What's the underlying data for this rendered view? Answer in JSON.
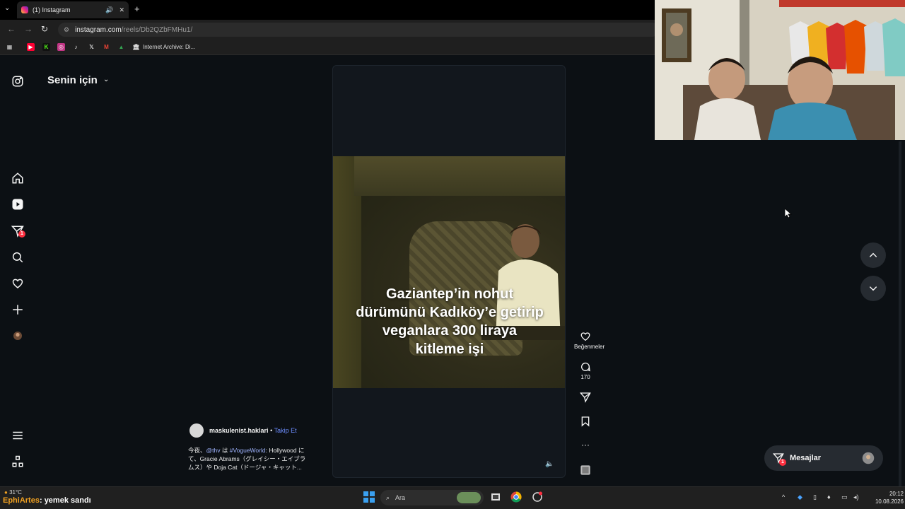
{
  "browser": {
    "tab_title": "(1) Instagram",
    "url_host": "instagram.com",
    "url_path": "/reels/Db2QZbFMHu1/",
    "bookmark_label": "Internet Archive: Di..."
  },
  "instagram": {
    "feed_title": "Senin için",
    "nav_badge": "1",
    "reel": {
      "caption_lines": [
        "Gaziantep’in nohut",
        "dürümünü Kadıköy’e getirip",
        "veganlara 300 liraya",
        "kitleme işi"
      ]
    },
    "actions": {
      "likes_label": "Beğenmeler",
      "comments_count": "170"
    },
    "author": {
      "username": "maskulenist.haklari",
      "separator": "•",
      "follow_label": "Takip Et",
      "desc_line1_pre": "今夜、",
      "desc_mention": "@thv",
      "desc_mid": " は ",
      "desc_hashtag": "#VogueWorld",
      "desc_line1_post": ": Hollywood に",
      "desc_line2": "て、Gracie Abrams（グレイシー・エイブラ",
      "desc_line3": "ムス）や Doja Cat（ドージャ・キャット..."
    },
    "messages_label": "Mesajlar",
    "messages_badge": "1"
  },
  "taskbar": {
    "temperature": "31°C",
    "overlay_brand": "EphiArtes",
    "overlay_rest": ": yemek sandı",
    "search_placeholder": "Ara",
    "time": "20:12",
    "date": "10.08.2026"
  },
  "colors": {
    "accent_blue": "#6d8dff",
    "badge_red": "#ff3040",
    "page_bg": "#0c1014"
  }
}
